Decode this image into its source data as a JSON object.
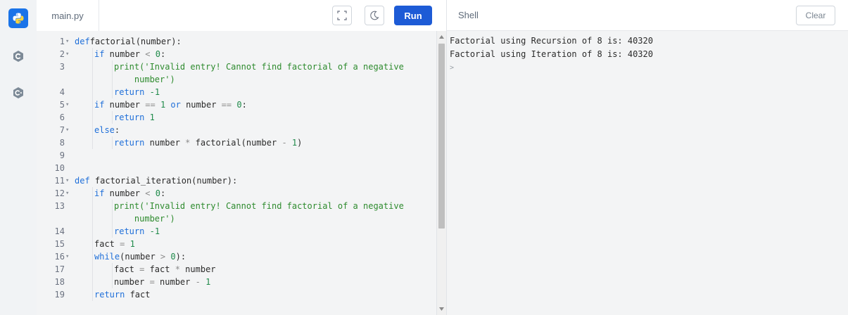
{
  "sidebar": {
    "items": [
      {
        "icon": "python-icon",
        "active": true
      },
      {
        "icon": "c-language-icon",
        "active": false
      },
      {
        "icon": "cpp-language-icon",
        "active": false
      }
    ]
  },
  "editor": {
    "tab_name": "main.py",
    "run_label": "Run",
    "lines": [
      {
        "n": "1",
        "fold": true,
        "indent": 0,
        "tokens": [
          [
            "kw",
            "def"
          ],
          [
            "",
            "factorial(number):"
          ]
        ]
      },
      {
        "n": "2",
        "fold": true,
        "indent": 1,
        "tokens": [
          [
            "kw",
            "if"
          ],
          [
            "",
            " number "
          ],
          [
            "op",
            "<"
          ],
          [
            "",
            " "
          ],
          [
            "num",
            "0"
          ],
          [
            "",
            ":"
          ]
        ]
      },
      {
        "n": "3",
        "fold": false,
        "indent": 2,
        "tokens": [
          [
            "",
            "print('Invalid entry! Cannot find factorial of a negative"
          ]
        ],
        "string": true
      },
      {
        "n": "",
        "fold": false,
        "indent": 2,
        "cont": "number')"
      },
      {
        "n": "4",
        "fold": false,
        "indent": 2,
        "tokens": [
          [
            "kw",
            "return"
          ],
          [
            "",
            " "
          ],
          [
            "num",
            "-1"
          ]
        ]
      },
      {
        "n": "5",
        "fold": true,
        "indent": 1,
        "tokens": [
          [
            "kw",
            "if"
          ],
          [
            "",
            " number "
          ],
          [
            "op",
            "=="
          ],
          [
            "",
            " "
          ],
          [
            "num",
            "1"
          ],
          [
            "",
            " "
          ],
          [
            "kw",
            "or"
          ],
          [
            "",
            " number "
          ],
          [
            "op",
            "=="
          ],
          [
            "",
            " "
          ],
          [
            "num",
            "0"
          ],
          [
            "",
            ":"
          ]
        ]
      },
      {
        "n": "6",
        "fold": false,
        "indent": 2,
        "tokens": [
          [
            "kw",
            "return"
          ],
          [
            "",
            " "
          ],
          [
            "num",
            "1"
          ]
        ]
      },
      {
        "n": "7",
        "fold": true,
        "indent": 1,
        "tokens": [
          [
            "kw",
            "else"
          ],
          [
            "",
            ":"
          ]
        ]
      },
      {
        "n": "8",
        "fold": false,
        "indent": 2,
        "tokens": [
          [
            "kw",
            "return"
          ],
          [
            "",
            " number "
          ],
          [
            "op",
            "*"
          ],
          [
            "",
            " factorial(number "
          ],
          [
            "op",
            "-"
          ],
          [
            "",
            " "
          ],
          [
            "num",
            "1"
          ],
          [
            "",
            ")"
          ]
        ]
      },
      {
        "n": "9",
        "fold": false,
        "indent": 0,
        "tokens": []
      },
      {
        "n": "10",
        "fold": false,
        "indent": 0,
        "tokens": []
      },
      {
        "n": "11",
        "fold": true,
        "indent": 0,
        "tokens": [
          [
            "kw",
            "def"
          ],
          [
            "",
            " factorial_iteration(number):"
          ]
        ]
      },
      {
        "n": "12",
        "fold": true,
        "indent": 1,
        "tokens": [
          [
            "kw",
            "if"
          ],
          [
            "",
            " number "
          ],
          [
            "op",
            "<"
          ],
          [
            "",
            " "
          ],
          [
            "num",
            "0"
          ],
          [
            "",
            ":"
          ]
        ]
      },
      {
        "n": "13",
        "fold": false,
        "indent": 2,
        "tokens": [
          [
            "",
            "print('Invalid entry! Cannot find factorial of a negative"
          ]
        ],
        "string": true
      },
      {
        "n": "",
        "fold": false,
        "indent": 2,
        "cont": "number')"
      },
      {
        "n": "14",
        "fold": false,
        "indent": 2,
        "tokens": [
          [
            "kw",
            "return"
          ],
          [
            "",
            " "
          ],
          [
            "num",
            "-1"
          ]
        ]
      },
      {
        "n": "15",
        "fold": false,
        "indent": 1,
        "tokens": [
          [
            "",
            "fact "
          ],
          [
            "op",
            "="
          ],
          [
            "",
            " "
          ],
          [
            "num",
            "1"
          ]
        ]
      },
      {
        "n": "16",
        "fold": true,
        "indent": 1,
        "tokens": [
          [
            "kw",
            "while"
          ],
          [
            "",
            "(number "
          ],
          [
            "op",
            ">"
          ],
          [
            "",
            " "
          ],
          [
            "num",
            "0"
          ],
          [
            "",
            "):"
          ]
        ]
      },
      {
        "n": "17",
        "fold": false,
        "indent": 2,
        "tokens": [
          [
            "",
            "fact "
          ],
          [
            "op",
            "="
          ],
          [
            "",
            " fact "
          ],
          [
            "op",
            "*"
          ],
          [
            "",
            " number"
          ]
        ]
      },
      {
        "n": "18",
        "fold": false,
        "indent": 2,
        "tokens": [
          [
            "",
            "number "
          ],
          [
            "op",
            "="
          ],
          [
            "",
            " number "
          ],
          [
            "op",
            "-"
          ],
          [
            "",
            " "
          ],
          [
            "num",
            "1"
          ]
        ]
      },
      {
        "n": "19",
        "fold": false,
        "indent": 1,
        "tokens": [
          [
            "kw",
            "return"
          ],
          [
            "",
            " fact"
          ]
        ]
      }
    ]
  },
  "shell": {
    "title": "Shell",
    "clear_label": "Clear",
    "output": [
      "Factorial using Recursion of 8 is: 40320",
      "Factorial using Iteration of 8 is: 40320"
    ],
    "prompt": ">"
  }
}
